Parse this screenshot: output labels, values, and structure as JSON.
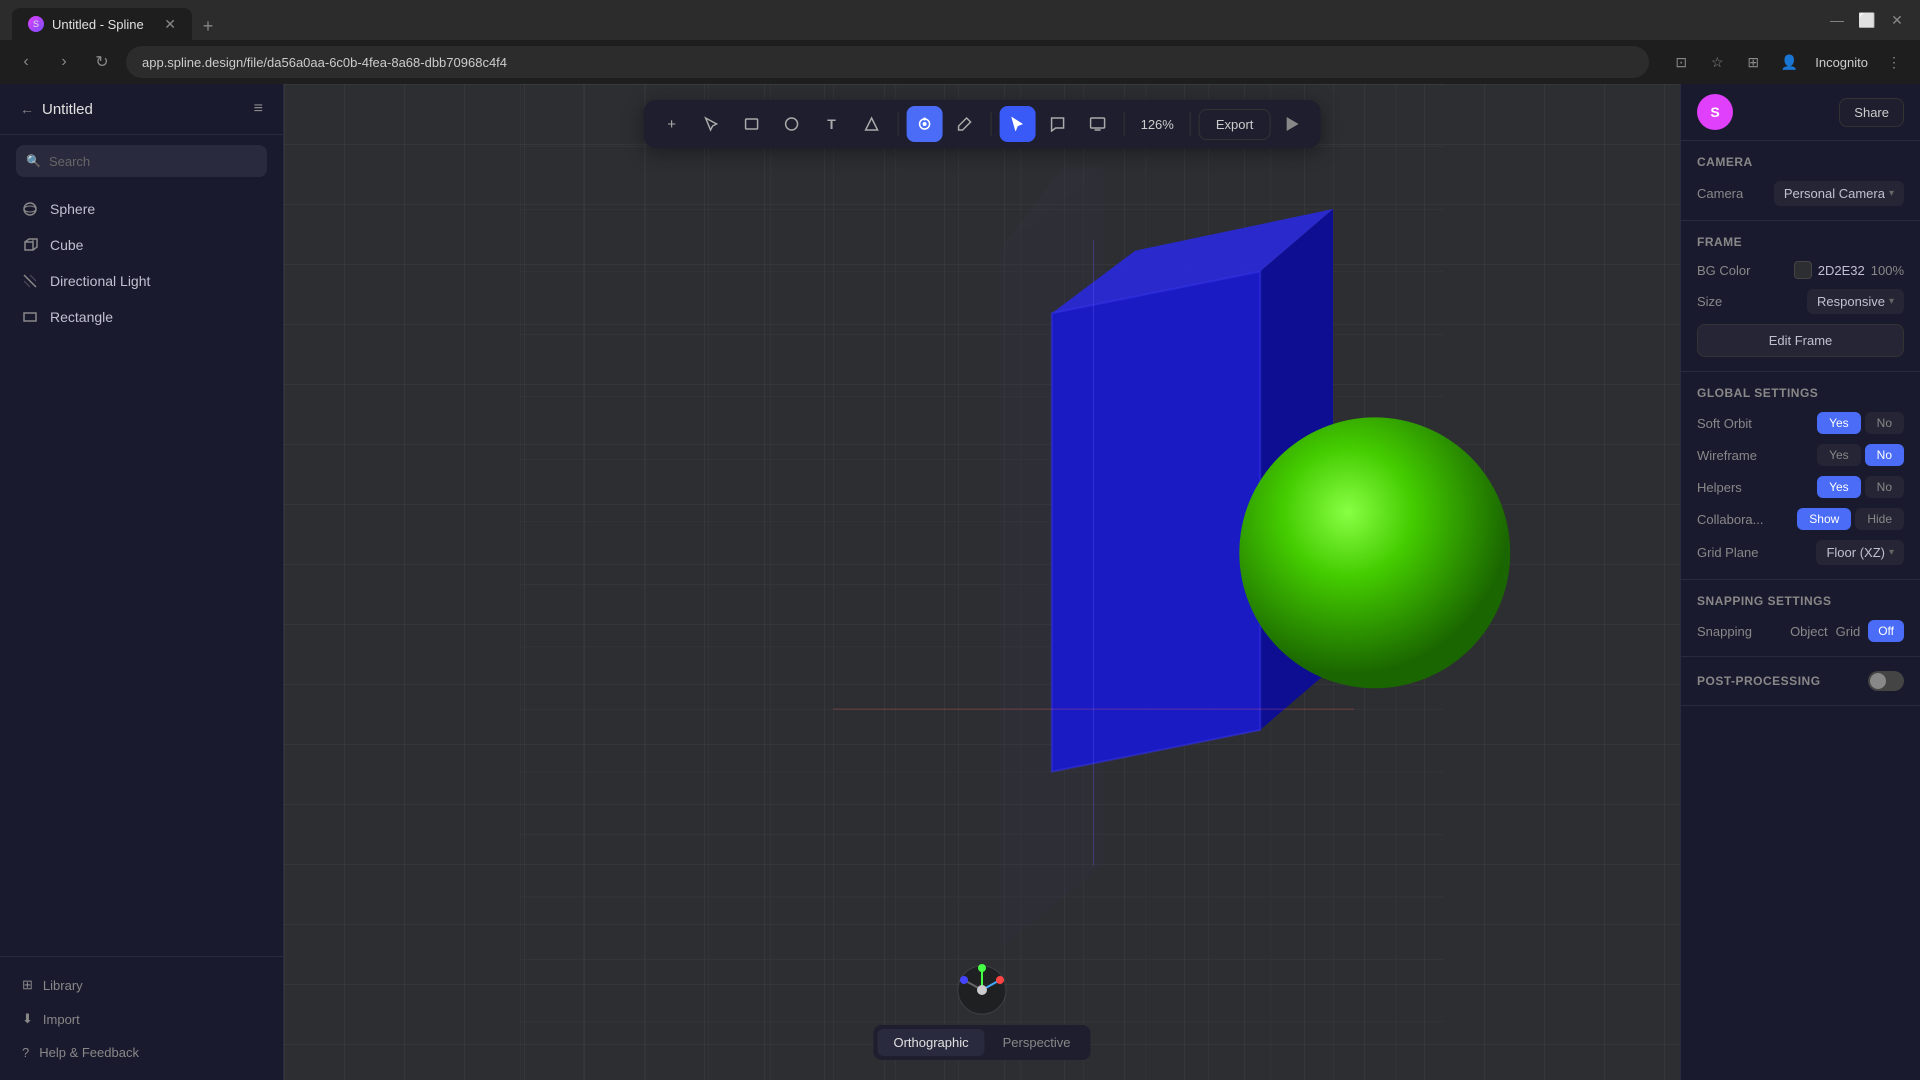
{
  "browser": {
    "tab": {
      "label": "Untitled - Spline",
      "favicon": "S"
    },
    "url": "app.spline.design/file/da56a0aa-6c0b-4fea-8a68-dbb70968c4f4",
    "incognito": "Incognito"
  },
  "sidebar": {
    "title": "Untitled",
    "search_placeholder": "Search",
    "items": [
      {
        "label": "Sphere",
        "icon": "⬤"
      },
      {
        "label": "Cube",
        "icon": "□"
      },
      {
        "label": "Directional Light",
        "icon": "⟋"
      },
      {
        "label": "Rectangle",
        "icon": "▭"
      }
    ],
    "bottom": [
      {
        "label": "Library",
        "icon": "⊞"
      },
      {
        "label": "Import",
        "icon": "⬇"
      },
      {
        "label": "Help & Feedback",
        "icon": "?"
      }
    ]
  },
  "toolbar": {
    "zoom": "126%",
    "export_label": "Export",
    "tools": [
      {
        "icon": "+",
        "name": "add",
        "active": false
      },
      {
        "icon": "✦",
        "name": "select",
        "active": false
      },
      {
        "icon": "▭",
        "name": "rectangle",
        "active": false
      },
      {
        "icon": "◯",
        "name": "circle",
        "active": false
      },
      {
        "icon": "T",
        "name": "text",
        "active": false
      },
      {
        "icon": "⬡",
        "name": "shape",
        "active": false
      },
      {
        "icon": "⟳",
        "name": "orbit",
        "active": true
      },
      {
        "icon": "⬧",
        "name": "pen",
        "active": false
      }
    ],
    "right_tools": [
      {
        "icon": "▶",
        "name": "pointer",
        "active": true
      },
      {
        "icon": "◯",
        "name": "comment",
        "active": false
      },
      {
        "icon": "⊞",
        "name": "screen",
        "active": false
      }
    ]
  },
  "viewport": {
    "view_modes": [
      {
        "label": "Orthographic",
        "active": true
      },
      {
        "label": "Perspective",
        "active": false
      }
    ]
  },
  "right_panel": {
    "user_initial": "S",
    "share_label": "Share",
    "camera": {
      "section": "Camera",
      "label": "Camera",
      "value": "Personal Camera"
    },
    "frame": {
      "section": "Frame",
      "bg_color_label": "BG Color",
      "bg_color_hex": "2D2E32",
      "bg_color_opacity": "100%",
      "size_label": "Size",
      "size_value": "Responsive",
      "edit_frame_label": "Edit Frame"
    },
    "global_settings": {
      "section": "Global Settings",
      "soft_orbit": {
        "label": "Soft Orbit",
        "yes": "Yes",
        "no": "No",
        "active": "yes"
      },
      "wireframe": {
        "label": "Wireframe",
        "yes": "Yes",
        "no": "No",
        "active": "no"
      },
      "helpers": {
        "label": "Helpers",
        "yes": "Yes",
        "no": "No",
        "active": "yes"
      },
      "collabora": {
        "label": "Collabora...",
        "show": "Show",
        "hide": "Hide",
        "active": "show"
      },
      "grid_plane": {
        "label": "Grid Plane",
        "value": "Floor (XZ)"
      }
    },
    "snapping": {
      "section": "Snapping Settings",
      "label": "Snapping",
      "object": "Object",
      "grid": "Grid",
      "off": "Off"
    },
    "post_processing": {
      "section": "Post-Processing",
      "enabled": false
    }
  }
}
